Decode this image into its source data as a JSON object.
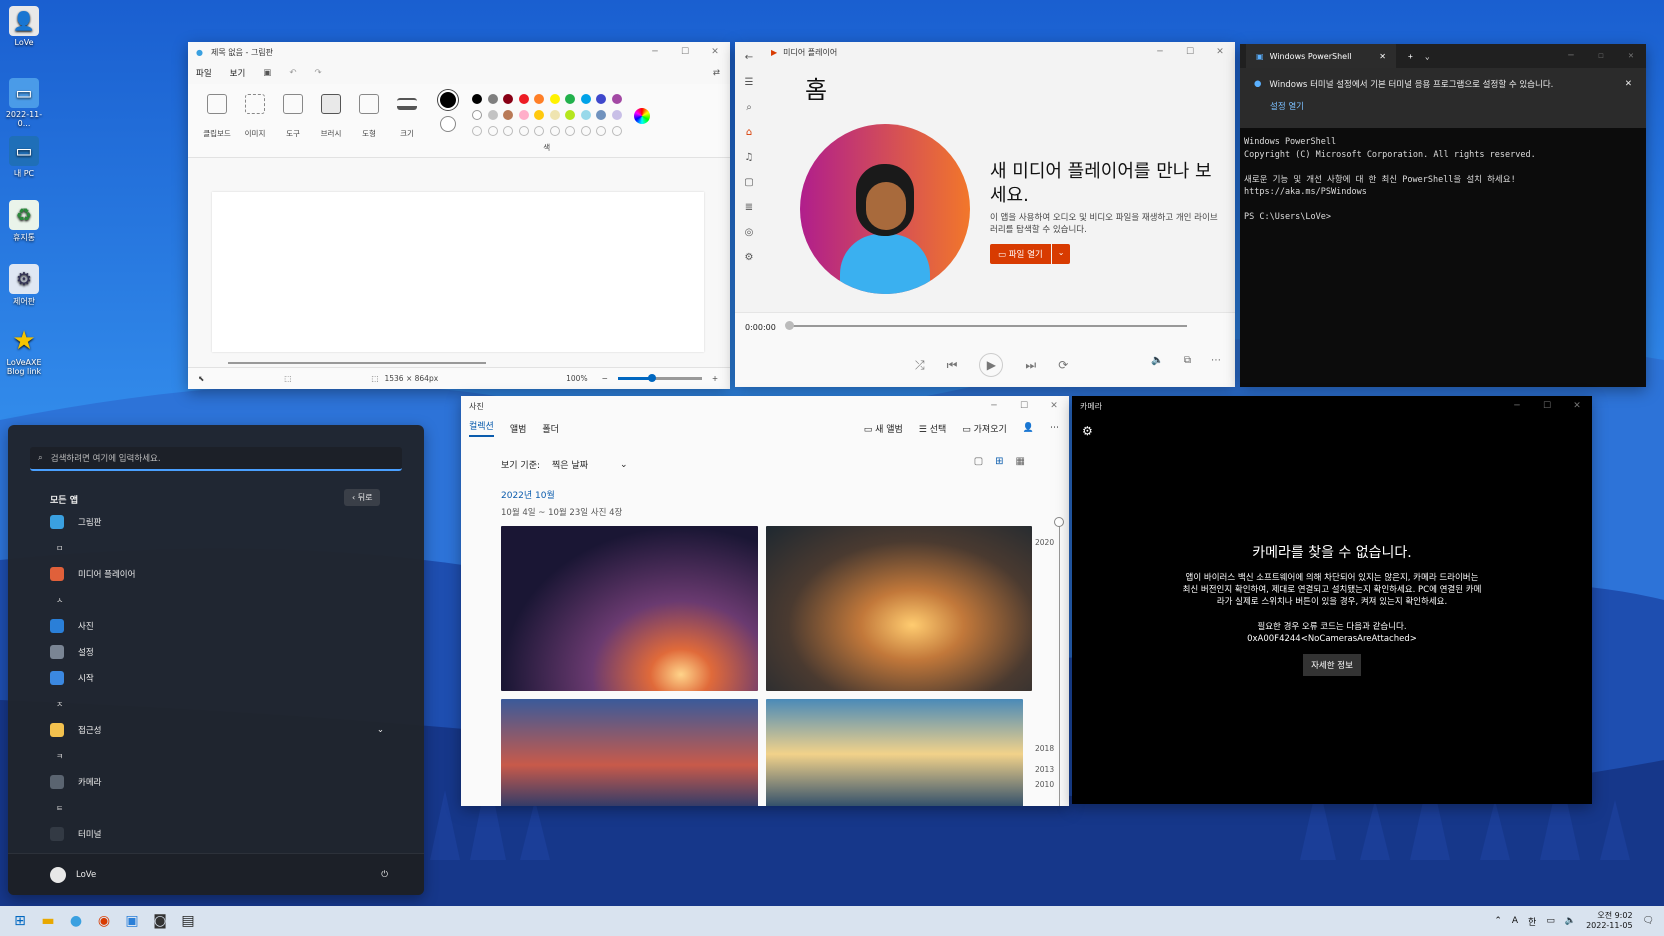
{
  "desktop": {
    "icons": [
      {
        "label": "LoVe",
        "icon": "user-folder-icon"
      },
      {
        "label": "2022-11-0...",
        "icon": "image-file-icon"
      },
      {
        "label": "내 PC",
        "icon": "pc-icon"
      },
      {
        "label": "휴지통",
        "icon": "recycle-bin-icon"
      },
      {
        "label": "제어판",
        "icon": "control-panel-icon"
      },
      {
        "label": "LoVeAXE\nBlog link",
        "icon": "star-shortcut-icon"
      }
    ]
  },
  "paint": {
    "title": "제목 없음 - 그림판",
    "menu": [
      "파일",
      "보기"
    ],
    "tools": [
      "클립보드",
      "이미지",
      "도구",
      "브러시",
      "도형",
      "크기"
    ],
    "colors_label": "색",
    "colors": [
      "#000000",
      "#7f7f7f",
      "#880015",
      "#ed1c24",
      "#ff7f27",
      "#fff200",
      "#22b14c",
      "#00a2e8",
      "#3f48cc",
      "#a349a4",
      "#ffffff",
      "#c3c3c3",
      "#b97a57",
      "#ffaec9",
      "#ffc90e",
      "#efe4b0",
      "#b5e61d",
      "#99d9ea",
      "#7092be",
      "#c8bfe7"
    ],
    "status_size": "1536 × 864px",
    "zoom": "100%"
  },
  "media": {
    "title": "미디어 플레이어",
    "heading": "홈",
    "headline": "새 미디어 플레이어를 만나 보세요.",
    "subtext": "이 앱을 사용하여 오디오 및 비디오 파일을 재생하고 개인 라이브러리를 탐색할 수 있습니다.",
    "open_button": "파일 열기",
    "time": "0:00:00",
    "accent": "#d83b01"
  },
  "powershell": {
    "tab": "Windows PowerShell",
    "info": "Windows 터미널 설정에서 기본 터미널 응용 프로그램으로 설정할 수 있습니다.",
    "info_link": "설정 열기",
    "lines": "Windows PowerShell\nCopyright (C) Microsoft Corporation. All rights reserved.\n\n새로운 기능 및 개선 사항에 대 한 최신 PowerShell을 설치 하세요! https://aka.ms/PSWindows\n\nPS C:\\Users\\LoVe>"
  },
  "photos": {
    "title": "사진",
    "tabs": [
      "컬렉션",
      "앨범",
      "폴더"
    ],
    "actions": [
      "새 앨범",
      "선택",
      "가져오기"
    ],
    "view_by_label": "보기 기준:",
    "view_by_value": "찍은 날짜",
    "month": "2022년 10월",
    "range": "10월 4일 ~ 10월 23일   사진 4장",
    "years": [
      "2020",
      "2018",
      "2013",
      "2010"
    ]
  },
  "camera": {
    "title": "카메라",
    "heading": "카메라를 찾을 수 없습니다.",
    "body": "앱이 바이러스 백신 소프트웨어에 의해 차단되어 있지는 않은지, 카메라 드라이버는 최신 버전인지 확인하여, 제대로 연결되고 설치됐는지 확인하세요. PC에 연결된 카메라가 실제로 스위치나 버튼이 있을 경우, 켜져 있는지 확인하세요.",
    "code_label": "필요한 경우 오류 코드는 다음과 같습니다.",
    "code": "0xA00F4244<NoCamerasAreAttached>",
    "button": "자세한 정보"
  },
  "start": {
    "search_placeholder": "검색하려면 여기에 입력하세요.",
    "all_apps": "모든 앱",
    "back": "뒤로",
    "apps": [
      {
        "type": "app",
        "label": "그림판",
        "color": "#3aa0e0"
      },
      {
        "type": "letter",
        "label": "ㅁ"
      },
      {
        "type": "app",
        "label": "미디어 플레이어",
        "color": "#e0603a"
      },
      {
        "type": "letter",
        "label": "ㅅ"
      },
      {
        "type": "app",
        "label": "사진",
        "color": "#2a7fd8"
      },
      {
        "type": "app",
        "label": "설정",
        "color": "#7a8594"
      },
      {
        "type": "app",
        "label": "시작",
        "color": "#3b88e0"
      },
      {
        "type": "letter",
        "label": "ㅈ"
      },
      {
        "type": "app",
        "label": "접근성",
        "color": "#f2c14e"
      },
      {
        "type": "letter",
        "label": "ㅋ"
      },
      {
        "type": "app",
        "label": "카메라",
        "color": "#5a6470"
      },
      {
        "type": "letter",
        "label": "ㅌ"
      },
      {
        "type": "app",
        "label": "터미널",
        "color": "#333a44"
      }
    ],
    "user": "LoVe"
  },
  "taskbar": {
    "ime": "한",
    "lang": "A",
    "time": "오전 9:02",
    "date": "2022-11-05"
  }
}
